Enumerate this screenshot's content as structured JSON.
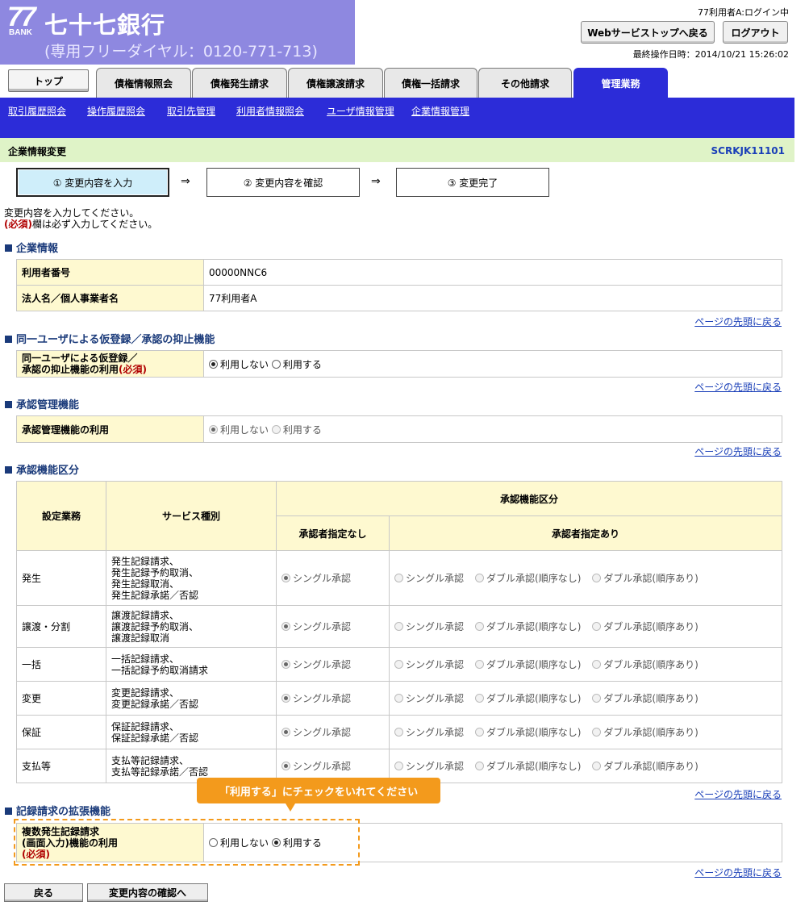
{
  "header": {
    "logo_number": "77",
    "logo_bank": "BANK",
    "bank_name": "七十七銀行",
    "dial": "(専用フリーダイヤル：0120-771-713)",
    "login_status": "77利用者A:ログイン中",
    "web_top_button": "Webサービストップへ戻る",
    "logout_button": "ログアウト",
    "last_operation": "最終操作日時：2014/10/21 15:26:02"
  },
  "tabs": [
    "トップ",
    "債権情報照会",
    "債権発生請求",
    "債権譲渡請求",
    "債権一括請求",
    "その他請求",
    "管理業務"
  ],
  "subnav": [
    "取引履歴照会",
    "操作履歴照会",
    "取引先管理",
    "利用者情報照会",
    "ユーザ情報管理",
    "企業情報管理"
  ],
  "page": {
    "title": "企業情報変更",
    "code": "SCRKJK11101"
  },
  "steps": [
    "① 変更内容を入力",
    "② 変更内容を確認",
    "③ 変更完了"
  ],
  "arrow": "⇒",
  "intro": {
    "line1": "変更内容を入力してください。",
    "req": "(必須)",
    "line2": "欄は必ず入力してください。"
  },
  "back_to_top": "ページの先頭に戻る",
  "company": {
    "section": "企業情報",
    "user_no_label": "利用者番号",
    "user_no": "00000NNC6",
    "name_label": "法人名／個人事業者名",
    "name": "77利用者A"
  },
  "suppress": {
    "section": "同一ユーザによる仮登録／承認の抑止機能",
    "label1": "同一ユーザによる仮登録／",
    "label2": "承認の抑止機能の利用",
    "req": "(必須)",
    "opt_no": "利用しない",
    "opt_yes": "利用する",
    "selected": "no"
  },
  "approval_mgmt": {
    "section": "承認管理機能",
    "label": "承認管理機能の利用",
    "opt_no": "利用しない",
    "opt_yes": "利用する",
    "selected": "no"
  },
  "approval_class": {
    "section": "承認機能区分",
    "col_business": "設定業務",
    "col_service": "サービス種別",
    "col_class": "承認機能区分",
    "col_no_approver": "承認者指定なし",
    "col_approver": "承認者指定あり",
    "opt_single": "シングル承認",
    "opt_double_unordered": "ダブル承認(順序なし)",
    "opt_double_ordered": "ダブル承認(順序あり)",
    "rows": [
      {
        "business": "発生",
        "services": [
          "発生記録請求、",
          "発生記録予約取消、",
          "発生記録取消、",
          "発生記録承諾／否認"
        ]
      },
      {
        "business": "譲渡・分割",
        "services": [
          "譲渡記録請求、",
          "譲渡記録予約取消、",
          "譲渡記録取消"
        ]
      },
      {
        "business": "一括",
        "services": [
          "一括記録請求、",
          "一括記録予約取消請求"
        ]
      },
      {
        "business": "変更",
        "services": [
          "変更記録請求、",
          "変更記録承諾／否認"
        ]
      },
      {
        "business": "保証",
        "services": [
          "保証記録請求、",
          "保証記録承諾／否認"
        ]
      },
      {
        "business": "支払等",
        "services": [
          "支払等記録請求、",
          "支払等記録承諾／否認"
        ]
      }
    ]
  },
  "extension": {
    "section": "記録請求の拡張機能",
    "label1": "複数発生記録請求",
    "label2": "(画面入力)機能の利用",
    "req": "(必須)",
    "opt_no": "利用しない",
    "opt_yes": "利用する",
    "selected": "yes"
  },
  "tooltip": "「利用する」にチェックをいれてください",
  "buttons": {
    "back": "戻る",
    "confirm": "変更内容の確認へ"
  },
  "colors": {
    "header_bg": "#8e88e0",
    "nav_bg": "#2c2cd8",
    "title_bg": "#dff3c7",
    "label_bg": "#fef9d0",
    "callout": "#f39a1c"
  }
}
